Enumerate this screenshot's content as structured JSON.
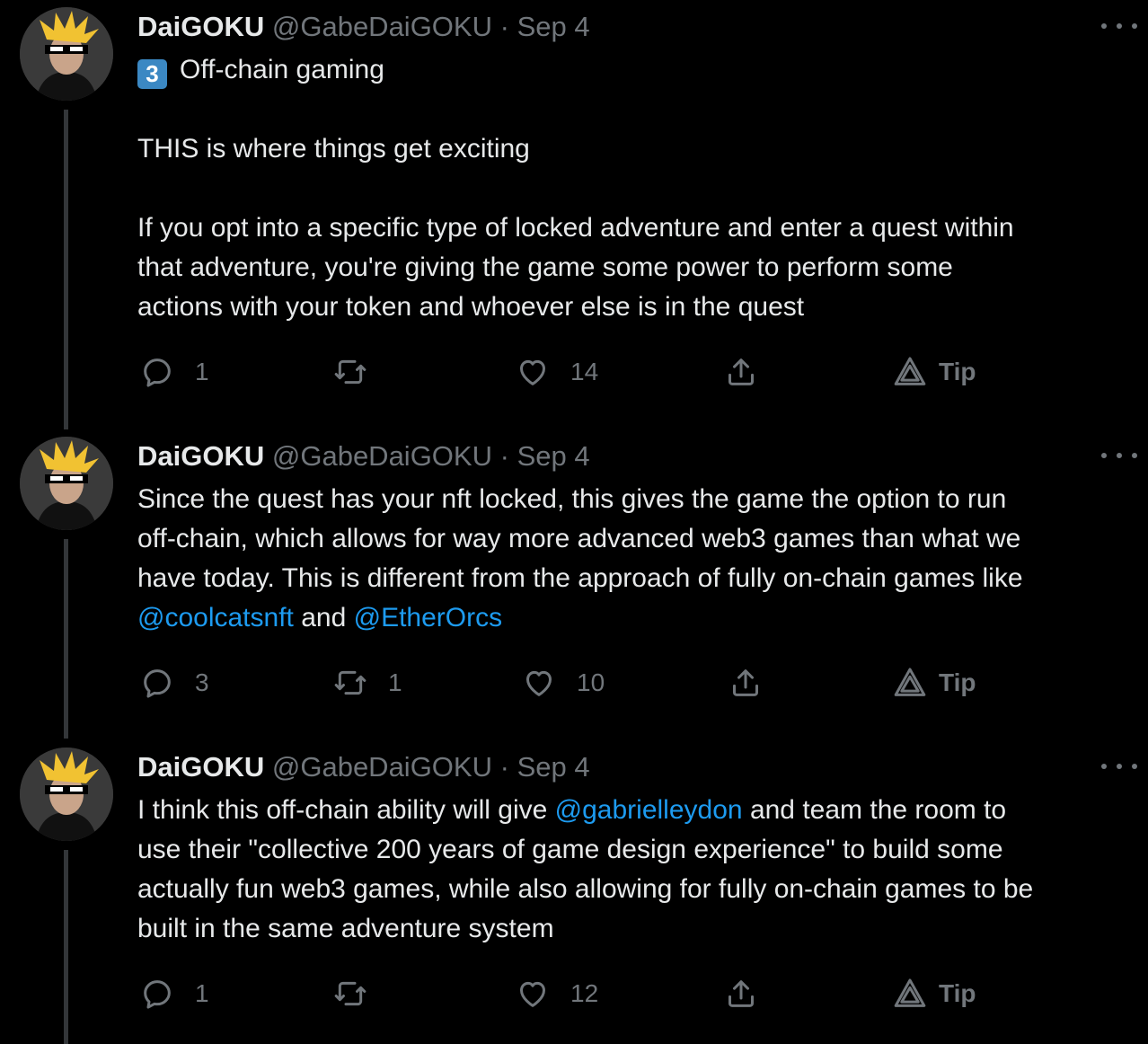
{
  "tweets": [
    {
      "name": "DaiGOKU",
      "handle": "@GabeDaiGOKU",
      "dot": "·",
      "date": "Sep 4",
      "keycap": "3",
      "lines": [
        "Off-chain gaming",
        "THIS is where things get exciting",
        "If you opt into a specific type of locked adventure and enter a quest within",
        "that adventure, you're giving the game some power to perform some",
        "actions with your token and whoever else is in the quest"
      ],
      "replies": "1",
      "retweets": "",
      "likes": "14",
      "tip": "Tip"
    },
    {
      "name": "DaiGOKU",
      "handle": "@GabeDaiGOKU",
      "dot": "·",
      "date": "Sep 4",
      "lines": [
        "Since the quest has your nft locked, this gives the game the option to run",
        "off-chain, which allows for way more advanced web3 games than what we",
        "have today. This is different from the approach of fully on-chain games like"
      ],
      "mention1": "@coolcatsnft",
      "and": "and",
      "mention2": "@EtherOrcs",
      "replies": "3",
      "retweets": "1",
      "likes": "10",
      "tip": "Tip"
    },
    {
      "name": "DaiGOKU",
      "handle": "@GabeDaiGOKU",
      "dot": "·",
      "date": "Sep 4",
      "line1_pre": "I think this off-chain ability will give",
      "mention": "@gabrielleydon",
      "line1_post": "and team the room to",
      "lines": [
        "use their \"collective 200 years of game design experience\" to build some",
        "actually fun web3 games, while also allowing for fully on-chain games to be",
        "built in the same adventure system"
      ],
      "replies": "1",
      "retweets": "",
      "likes": "12",
      "tip": "Tip"
    }
  ],
  "icons": [
    "reply-icon",
    "retweet-icon",
    "like-icon",
    "share-icon",
    "tip-icon",
    "more-icon"
  ],
  "colors": {
    "background": "#000000",
    "text": "#e7e9ea",
    "muted": "#71767b",
    "link": "#1d9bf0",
    "thread_line": "#333639",
    "keycap": "#3b88c3"
  }
}
